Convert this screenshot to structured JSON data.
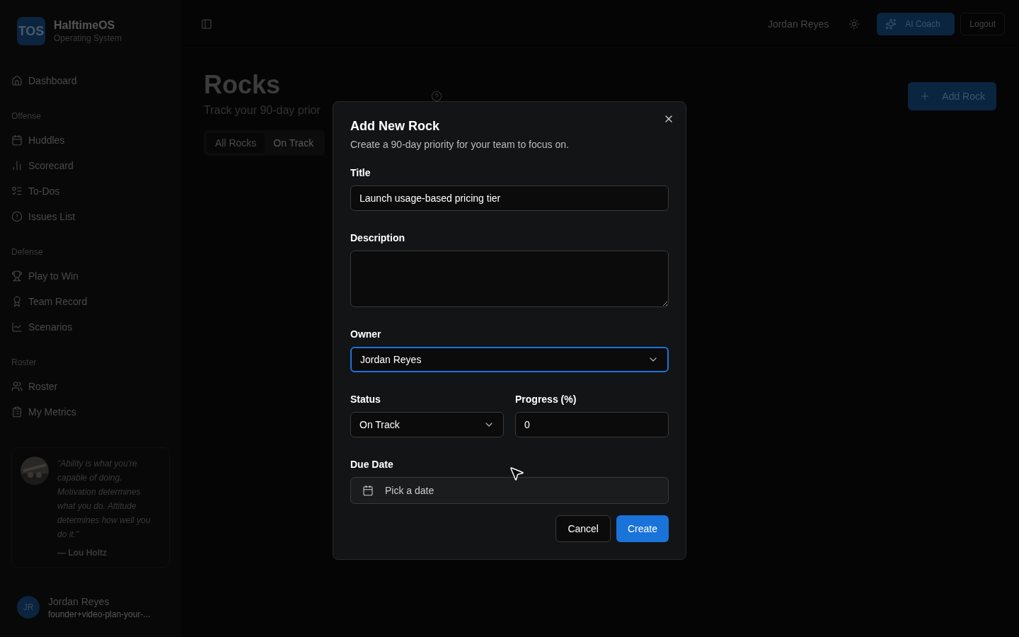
{
  "brand": {
    "logo": "TOS",
    "name": "HalftimeOS",
    "tagline": "Operating System"
  },
  "sidebar": {
    "sections": [
      {
        "items": [
          {
            "label": "Dashboard"
          }
        ]
      },
      {
        "heading": "Offense",
        "items": [
          {
            "label": "Huddles"
          },
          {
            "label": "Scorecard"
          },
          {
            "label": "To-Dos"
          },
          {
            "label": "Issues List"
          }
        ]
      },
      {
        "heading": "Defense",
        "items": [
          {
            "label": "Play to Win"
          },
          {
            "label": "Team Record"
          },
          {
            "label": "Scenarios"
          }
        ]
      },
      {
        "heading": "Roster",
        "items": [
          {
            "label": "Roster"
          },
          {
            "label": "My Metrics"
          }
        ]
      }
    ],
    "quote": {
      "text": "\"Ability is what you're capable of doing. Motivation determines what you do. Attitude determines how well you do it.\"",
      "author": "— Lou Holtz"
    },
    "user": {
      "initials": "JR",
      "name": "Jordan Reyes",
      "email": "founder+video-plan-your-..."
    }
  },
  "topbar": {
    "user": "Jordan Reyes",
    "coach": "AI Coach",
    "logout": "Logout"
  },
  "page": {
    "title": "Rocks",
    "subtitle": "Track your 90-day prior",
    "add": "Add Rock",
    "tabs": [
      {
        "label": "All Rocks",
        "selected": true
      },
      {
        "label": "On Track",
        "selected": false
      }
    ]
  },
  "dialog": {
    "title": "Add New Rock",
    "description": "Create a 90-day priority for your team to focus on.",
    "title_label": "Title",
    "title_value": "Launch usage-based pricing tier",
    "description_label": "Description",
    "owner_label": "Owner",
    "owner_value": "Jordan Reyes",
    "owner_focused": true,
    "status_label": "Status",
    "status_value": "On Track",
    "progress_label": "Progress (%)",
    "progress_value": "0",
    "due_label": "Due Date",
    "due_placeholder": "Pick a date",
    "cancel": "Cancel",
    "create": "Create"
  }
}
